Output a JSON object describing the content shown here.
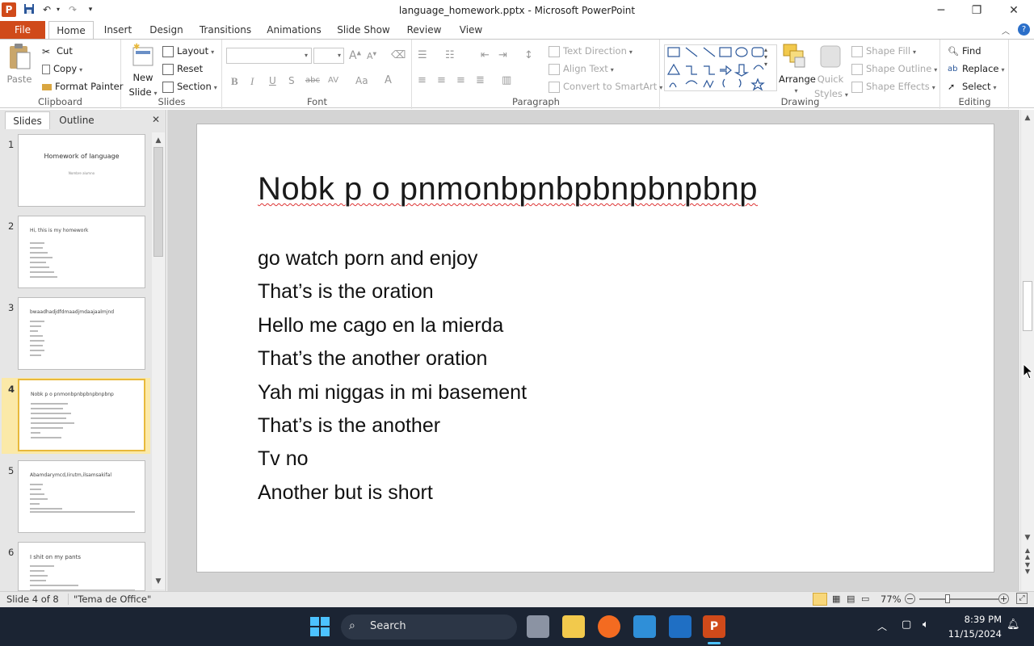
{
  "window": {
    "title": "language_homework.pptx  -  Microsoft PowerPoint",
    "app_icon": "P"
  },
  "tabs": [
    "File",
    "Home",
    "Insert",
    "Design",
    "Transitions",
    "Animations",
    "Slide Show",
    "Review",
    "View"
  ],
  "ribbon": {
    "clipboard": {
      "label": "Clipboard",
      "paste": "Paste",
      "cut": "Cut",
      "copy": "Copy",
      "format_painter": "Format Painter"
    },
    "slides": {
      "label": "Slides",
      "new_slide": "New",
      "new_slide2": "Slide",
      "layout": "Layout",
      "reset": "Reset",
      "section": "Section"
    },
    "font": {
      "label": "Font",
      "bold": "B",
      "italic": "I",
      "underline": "U",
      "strike": "abc",
      "shadow": "S",
      "spacing": "AV",
      "case": "Aa",
      "color": "A"
    },
    "paragraph": {
      "label": "Paragraph",
      "text_direction": "Text Direction",
      "align_text": "Align Text",
      "convert_smartart": "Convert to SmartArt"
    },
    "drawing": {
      "label": "Drawing",
      "arrange": "Arrange",
      "quick_styles": "Quick",
      "quick_styles2": "Styles",
      "shape_fill": "Shape Fill",
      "shape_outline": "Shape Outline",
      "shape_effects": "Shape Effects"
    },
    "editing": {
      "label": "Editing",
      "find": "Find",
      "replace": "Replace",
      "select": "Select"
    }
  },
  "pane": {
    "tabs": [
      "Slides",
      "Outline"
    ],
    "thumbs": [
      {
        "num": "1",
        "title": "Homework of language",
        "sub": "Nombre alumno"
      },
      {
        "num": "2",
        "title": "Hi, this is my homework"
      },
      {
        "num": "3",
        "title": "bwaadhadjdfdmaadjmdaajaalmjnd"
      },
      {
        "num": "4",
        "title": "Nobk p o pnmonbpnbpbnpbnpbnp"
      },
      {
        "num": "5",
        "title": "Abamdarymcd,Iirutm,ilsamsakifal"
      },
      {
        "num": "6",
        "title": "I shit on my pants"
      }
    ]
  },
  "slide": {
    "title": "Nobk p o pnmonbpnbpbnpbnpbnp",
    "lines": [
      "go watch porn and enjoy",
      "That’s is the oration",
      "Hello me cago en la mierda",
      "That’s the another oration",
      "Yah mi niggas in mi basement",
      "That’s is the another",
      "Tv no",
      "Another but is short"
    ]
  },
  "status": {
    "slide_of": "Slide 4 of 8",
    "theme": "\"Tema de Office\"",
    "zoom": "77%"
  },
  "taskbar": {
    "search": "Search",
    "time": "8:39 PM",
    "date": "11/15/2024"
  },
  "colors": {
    "file_tab": "#d04a1a",
    "selected_thumb": "#e8b93b",
    "taskbar": "#1b2433"
  }
}
